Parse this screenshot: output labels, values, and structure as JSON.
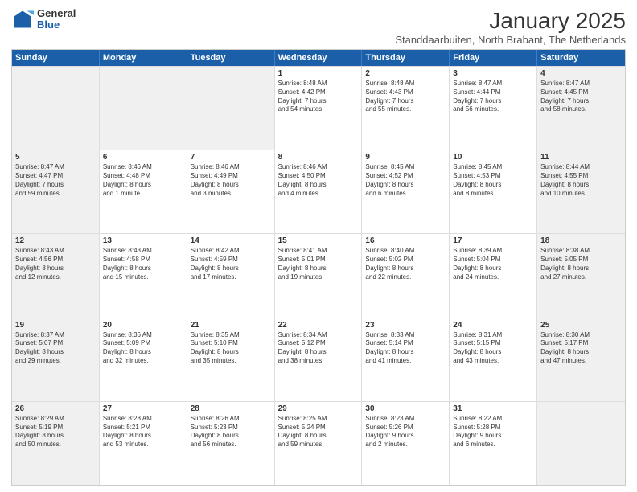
{
  "logo": {
    "general": "General",
    "blue": "Blue"
  },
  "header": {
    "month": "January 2025",
    "location": "Standdaarbuiten, North Brabant, The Netherlands"
  },
  "weekdays": [
    "Sunday",
    "Monday",
    "Tuesday",
    "Wednesday",
    "Thursday",
    "Friday",
    "Saturday"
  ],
  "rows": [
    [
      {
        "day": "",
        "info": "",
        "shaded": true
      },
      {
        "day": "",
        "info": "",
        "shaded": true
      },
      {
        "day": "",
        "info": "",
        "shaded": true
      },
      {
        "day": "1",
        "info": "Sunrise: 8:48 AM\nSunset: 4:42 PM\nDaylight: 7 hours\nand 54 minutes.",
        "shaded": false
      },
      {
        "day": "2",
        "info": "Sunrise: 8:48 AM\nSunset: 4:43 PM\nDaylight: 7 hours\nand 55 minutes.",
        "shaded": false
      },
      {
        "day": "3",
        "info": "Sunrise: 8:47 AM\nSunset: 4:44 PM\nDaylight: 7 hours\nand 56 minutes.",
        "shaded": false
      },
      {
        "day": "4",
        "info": "Sunrise: 8:47 AM\nSunset: 4:45 PM\nDaylight: 7 hours\nand 58 minutes.",
        "shaded": true
      }
    ],
    [
      {
        "day": "5",
        "info": "Sunrise: 8:47 AM\nSunset: 4:47 PM\nDaylight: 7 hours\nand 59 minutes.",
        "shaded": true
      },
      {
        "day": "6",
        "info": "Sunrise: 8:46 AM\nSunset: 4:48 PM\nDaylight: 8 hours\nand 1 minute.",
        "shaded": false
      },
      {
        "day": "7",
        "info": "Sunrise: 8:46 AM\nSunset: 4:49 PM\nDaylight: 8 hours\nand 3 minutes.",
        "shaded": false
      },
      {
        "day": "8",
        "info": "Sunrise: 8:46 AM\nSunset: 4:50 PM\nDaylight: 8 hours\nand 4 minutes.",
        "shaded": false
      },
      {
        "day": "9",
        "info": "Sunrise: 8:45 AM\nSunset: 4:52 PM\nDaylight: 8 hours\nand 6 minutes.",
        "shaded": false
      },
      {
        "day": "10",
        "info": "Sunrise: 8:45 AM\nSunset: 4:53 PM\nDaylight: 8 hours\nand 8 minutes.",
        "shaded": false
      },
      {
        "day": "11",
        "info": "Sunrise: 8:44 AM\nSunset: 4:55 PM\nDaylight: 8 hours\nand 10 minutes.",
        "shaded": true
      }
    ],
    [
      {
        "day": "12",
        "info": "Sunrise: 8:43 AM\nSunset: 4:56 PM\nDaylight: 8 hours\nand 12 minutes.",
        "shaded": true
      },
      {
        "day": "13",
        "info": "Sunrise: 8:43 AM\nSunset: 4:58 PM\nDaylight: 8 hours\nand 15 minutes.",
        "shaded": false
      },
      {
        "day": "14",
        "info": "Sunrise: 8:42 AM\nSunset: 4:59 PM\nDaylight: 8 hours\nand 17 minutes.",
        "shaded": false
      },
      {
        "day": "15",
        "info": "Sunrise: 8:41 AM\nSunset: 5:01 PM\nDaylight: 8 hours\nand 19 minutes.",
        "shaded": false
      },
      {
        "day": "16",
        "info": "Sunrise: 8:40 AM\nSunset: 5:02 PM\nDaylight: 8 hours\nand 22 minutes.",
        "shaded": false
      },
      {
        "day": "17",
        "info": "Sunrise: 8:39 AM\nSunset: 5:04 PM\nDaylight: 8 hours\nand 24 minutes.",
        "shaded": false
      },
      {
        "day": "18",
        "info": "Sunrise: 8:38 AM\nSunset: 5:05 PM\nDaylight: 8 hours\nand 27 minutes.",
        "shaded": true
      }
    ],
    [
      {
        "day": "19",
        "info": "Sunrise: 8:37 AM\nSunset: 5:07 PM\nDaylight: 8 hours\nand 29 minutes.",
        "shaded": true
      },
      {
        "day": "20",
        "info": "Sunrise: 8:36 AM\nSunset: 5:09 PM\nDaylight: 8 hours\nand 32 minutes.",
        "shaded": false
      },
      {
        "day": "21",
        "info": "Sunrise: 8:35 AM\nSunset: 5:10 PM\nDaylight: 8 hours\nand 35 minutes.",
        "shaded": false
      },
      {
        "day": "22",
        "info": "Sunrise: 8:34 AM\nSunset: 5:12 PM\nDaylight: 8 hours\nand 38 minutes.",
        "shaded": false
      },
      {
        "day": "23",
        "info": "Sunrise: 8:33 AM\nSunset: 5:14 PM\nDaylight: 8 hours\nand 41 minutes.",
        "shaded": false
      },
      {
        "day": "24",
        "info": "Sunrise: 8:31 AM\nSunset: 5:15 PM\nDaylight: 8 hours\nand 43 minutes.",
        "shaded": false
      },
      {
        "day": "25",
        "info": "Sunrise: 8:30 AM\nSunset: 5:17 PM\nDaylight: 8 hours\nand 47 minutes.",
        "shaded": true
      }
    ],
    [
      {
        "day": "26",
        "info": "Sunrise: 8:29 AM\nSunset: 5:19 PM\nDaylight: 8 hours\nand 50 minutes.",
        "shaded": true
      },
      {
        "day": "27",
        "info": "Sunrise: 8:28 AM\nSunset: 5:21 PM\nDaylight: 8 hours\nand 53 minutes.",
        "shaded": false
      },
      {
        "day": "28",
        "info": "Sunrise: 8:26 AM\nSunset: 5:23 PM\nDaylight: 8 hours\nand 56 minutes.",
        "shaded": false
      },
      {
        "day": "29",
        "info": "Sunrise: 8:25 AM\nSunset: 5:24 PM\nDaylight: 8 hours\nand 59 minutes.",
        "shaded": false
      },
      {
        "day": "30",
        "info": "Sunrise: 8:23 AM\nSunset: 5:26 PM\nDaylight: 9 hours\nand 2 minutes.",
        "shaded": false
      },
      {
        "day": "31",
        "info": "Sunrise: 8:22 AM\nSunset: 5:28 PM\nDaylight: 9 hours\nand 6 minutes.",
        "shaded": false
      },
      {
        "day": "",
        "info": "",
        "shaded": true
      }
    ]
  ]
}
